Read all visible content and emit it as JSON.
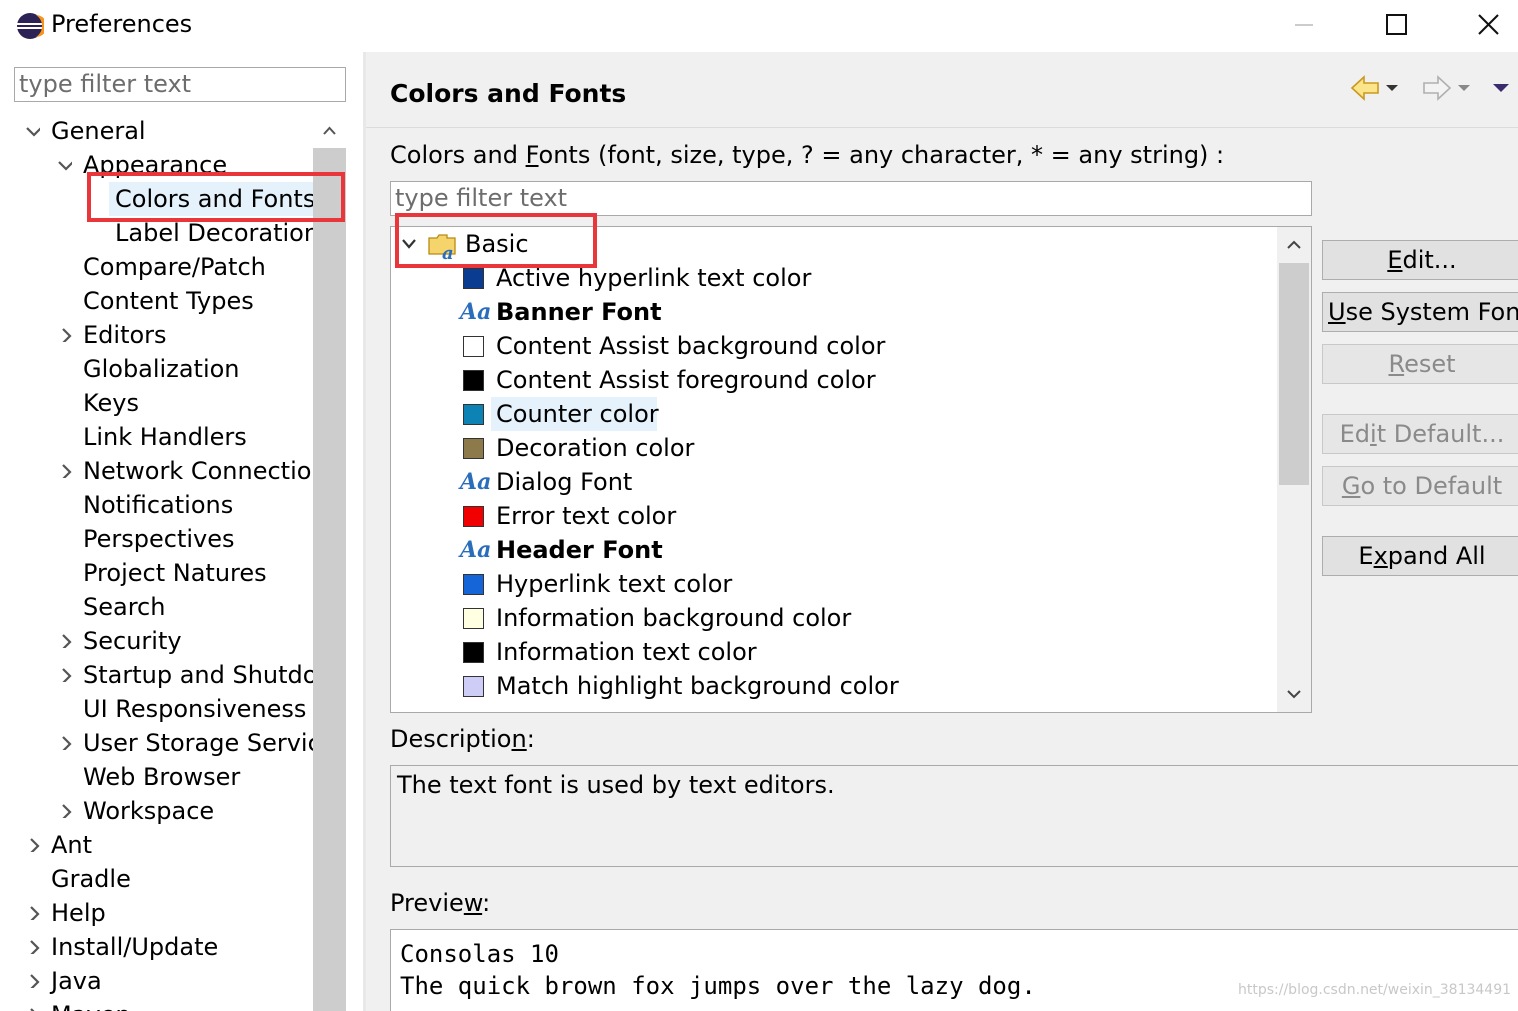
{
  "window": {
    "title": "Preferences"
  },
  "left": {
    "filter_placeholder": "type filter text",
    "tree": [
      {
        "label": "General",
        "expand": "expanded"
      },
      {
        "label": "Appearance",
        "expand": "expanded"
      },
      {
        "label": "Colors and Fonts",
        "expand": "none",
        "selected": true
      },
      {
        "label": "Label Decorations",
        "expand": "none"
      },
      {
        "label": "Compare/Patch",
        "expand": "none"
      },
      {
        "label": "Content Types",
        "expand": "none"
      },
      {
        "label": "Editors",
        "expand": "collapsed"
      },
      {
        "label": "Globalization",
        "expand": "none"
      },
      {
        "label": "Keys",
        "expand": "none"
      },
      {
        "label": "Link Handlers",
        "expand": "none"
      },
      {
        "label": "Network Connections",
        "expand": "collapsed"
      },
      {
        "label": "Notifications",
        "expand": "none"
      },
      {
        "label": "Perspectives",
        "expand": "none"
      },
      {
        "label": "Project Natures",
        "expand": "none"
      },
      {
        "label": "Search",
        "expand": "none"
      },
      {
        "label": "Security",
        "expand": "collapsed"
      },
      {
        "label": "Startup and Shutdown",
        "expand": "collapsed"
      },
      {
        "label": "UI Responsiveness Monitoring",
        "expand": "none"
      },
      {
        "label": "User Storage Service",
        "expand": "collapsed"
      },
      {
        "label": "Web Browser",
        "expand": "none"
      },
      {
        "label": "Workspace",
        "expand": "collapsed"
      },
      {
        "label": "Ant",
        "expand": "collapsed"
      },
      {
        "label": "Gradle",
        "expand": "none"
      },
      {
        "label": "Help",
        "expand": "collapsed"
      },
      {
        "label": "Install/Update",
        "expand": "collapsed"
      },
      {
        "label": "Java",
        "expand": "collapsed"
      },
      {
        "label": "Maven",
        "expand": "collapsed"
      }
    ]
  },
  "right": {
    "title": "Colors and Fonts",
    "filter_label_pre": "Colors and ",
    "filter_label_mnemonic": "F",
    "filter_label_post": "onts (font, size, type, ? = any character, * = any string) :",
    "filter_placeholder": "type filter text",
    "category": "Basic",
    "items": [
      {
        "kind": "color",
        "color": "#0a3d91",
        "label": "Active hyperlink text color"
      },
      {
        "kind": "font",
        "bold": true,
        "label": "Banner Font"
      },
      {
        "kind": "color",
        "color": "#ffffff",
        "label": "Content Assist background color"
      },
      {
        "kind": "color",
        "color": "#000000",
        "label": "Content Assist foreground color"
      },
      {
        "kind": "color",
        "color": "#0d82b5",
        "label": "Counter color",
        "highlight": true
      },
      {
        "kind": "color",
        "color": "#8c7a4a",
        "label": "Decoration color"
      },
      {
        "kind": "font",
        "bold": false,
        "label": "Dialog Font"
      },
      {
        "kind": "color",
        "color": "#f00000",
        "label": "Error text color"
      },
      {
        "kind": "font",
        "bold": true,
        "label": "Header Font"
      },
      {
        "kind": "color",
        "color": "#1565d8",
        "label": "Hyperlink text color"
      },
      {
        "kind": "color",
        "color": "#ffffe1",
        "label": "Information background color"
      },
      {
        "kind": "color",
        "color": "#000000",
        "label": "Information text color"
      },
      {
        "kind": "color",
        "color": "#cdcdf7",
        "label": "Match highlight background color"
      }
    ],
    "font_icon_text": "Aa",
    "buttons": {
      "edit": {
        "pre": "",
        "u": "E",
        "post": "dit..."
      },
      "use_system_font": {
        "pre": "",
        "u": "U",
        "post": "se System Font"
      },
      "reset": {
        "pre": "",
        "u": "R",
        "post": "eset"
      },
      "edit_default": {
        "pre": "Ed",
        "u": "i",
        "post": "t Default..."
      },
      "go_to_default": {
        "pre": "",
        "u": "G",
        "post": "o to Default"
      },
      "expand_all": {
        "pre": "E",
        "u": "x",
        "post": "pand All"
      }
    },
    "description": {
      "label_pre": "Description",
      "label_u": ":",
      "label_pre2": "Descriptio",
      "label_mn": "n",
      "label_post": ":",
      "text": "The text font is used by text editors."
    },
    "preview": {
      "label_pre": "Previe",
      "label_mn": "w",
      "label_post": ":",
      "line1": "Consolas 10",
      "line2": "The quick brown fox jumps over the lazy dog."
    }
  },
  "watermark": "https://blog.csdn.net/weixin_38134491",
  "colors": {
    "annotation_red": "#e8363a",
    "selection": "#e5f1fb"
  }
}
